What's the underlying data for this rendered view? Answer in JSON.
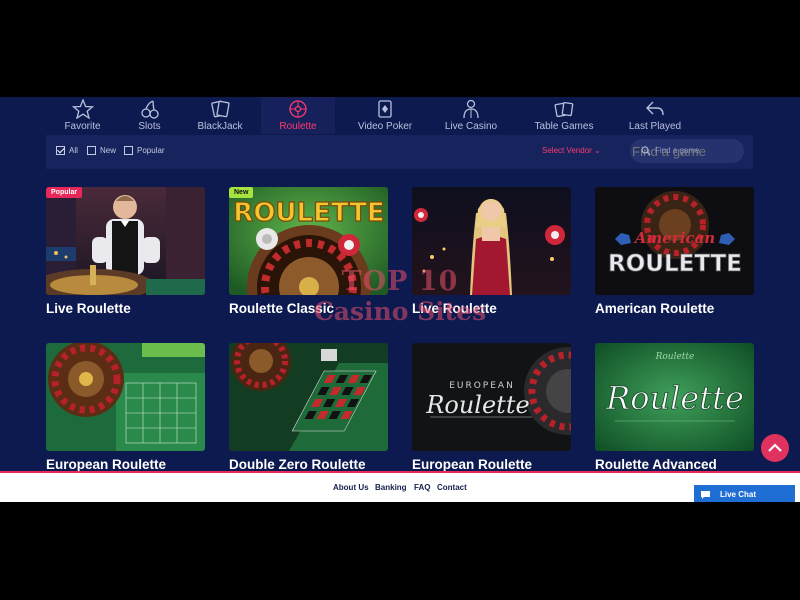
{
  "nav": {
    "items": [
      {
        "label": "Favorite",
        "icon": "star-icon"
      },
      {
        "label": "Slots",
        "icon": "cherry-icon"
      },
      {
        "label": "BlackJack",
        "icon": "cards-icon"
      },
      {
        "label": "Roulette",
        "icon": "roulette-wheel-icon",
        "active": true
      },
      {
        "label": "Video Poker",
        "icon": "poker-icon"
      },
      {
        "label": "Live Casino",
        "icon": "dealer-icon"
      },
      {
        "label": "Table Games",
        "icon": "table-cards-icon"
      },
      {
        "label": "Last Played",
        "icon": "back-arrow-icon"
      }
    ]
  },
  "filters": {
    "all": "All",
    "new": "New",
    "popular": "Popular",
    "vendor": "Select Vendor",
    "search_placeholder": "Find a game"
  },
  "games": [
    {
      "name": "Live Roulette",
      "badge": "Popular"
    },
    {
      "name": "Roulette Classic",
      "badge": "New",
      "art_text": "ROULETTE"
    },
    {
      "name": "Live Roulette",
      "badge": ""
    },
    {
      "name": "American Roulette",
      "badge": "",
      "art_text_1": "American",
      "art_text_2": "ROULETTE"
    },
    {
      "name": "European Roulette",
      "badge": ""
    },
    {
      "name": "Double Zero Roulette",
      "badge": ""
    },
    {
      "name": "European Roulette",
      "badge": "",
      "art_text_1": "EUROPEAN",
      "art_text_2": "Roulette"
    },
    {
      "name": "Roulette Advanced",
      "badge": "",
      "art_text_1": "Roulette",
      "art_text_2": "Roulette"
    }
  ],
  "watermark": {
    "line1": "TOP 10",
    "line2": "Casino Sites"
  },
  "footer": {
    "links": [
      "About Us",
      "Banking",
      "FAQ",
      "Contact"
    ],
    "live_chat": "Live Chat"
  },
  "colors": {
    "background": "#0d1a4f",
    "accent": "#ff3a6e",
    "panel": "#16235d",
    "chat": "#1f6ed4"
  }
}
